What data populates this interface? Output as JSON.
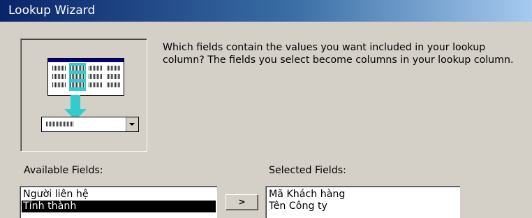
{
  "window": {
    "title": "Lookup Wizard"
  },
  "instruction": "Which fields contain the values you want included in your lookup column? The fields you select become columns in your lookup column.",
  "available": {
    "label": "Available Fields:",
    "items": [
      "Người liên hệ",
      "Tỉnh thành"
    ],
    "selected_index": 1
  },
  "selected_fields": {
    "label": "Selected Fields:",
    "items": [
      "Mã Khách hàng",
      "Tên Công ty"
    ]
  },
  "add_button_label": ">",
  "illustration": {
    "icon": "lookup-wizard-illustration",
    "accent": "#33cccc",
    "header": "#000080"
  },
  "colors": {
    "title_bar": "#0a246a",
    "selection": "#000000",
    "dialog": "#d4d0c8"
  }
}
